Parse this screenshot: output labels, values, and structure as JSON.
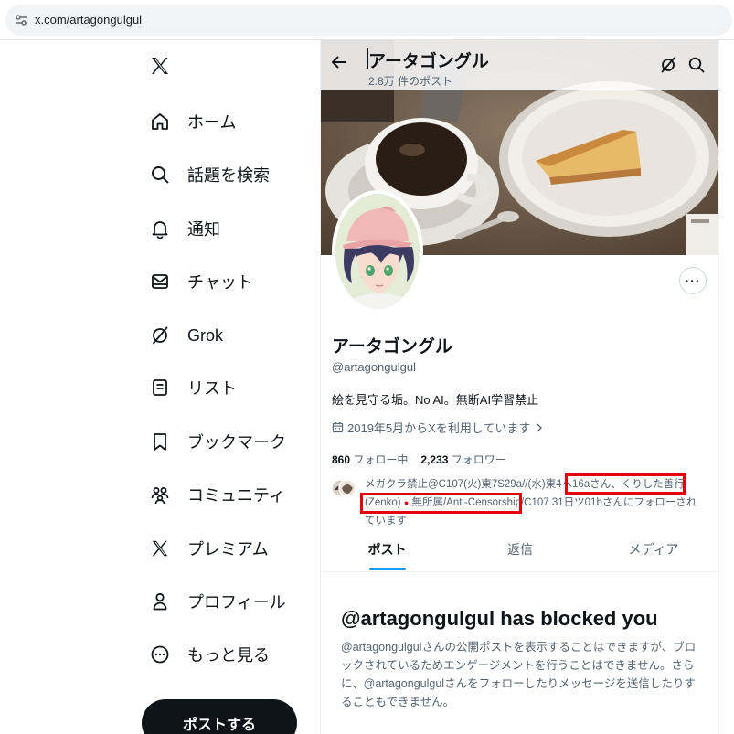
{
  "browser": {
    "url": "x.com/artagongulgul"
  },
  "nav": {
    "items": [
      {
        "label": "ホーム",
        "icon": "home-icon"
      },
      {
        "label": "話題を検索",
        "icon": "search-icon"
      },
      {
        "label": "通知",
        "icon": "bell-icon"
      },
      {
        "label": "チャット",
        "icon": "envelope-icon"
      },
      {
        "label": "Grok",
        "icon": "grok-icon"
      },
      {
        "label": "リスト",
        "icon": "list-icon"
      },
      {
        "label": "ブックマーク",
        "icon": "bookmark-icon"
      },
      {
        "label": "コミュニティ",
        "icon": "community-icon"
      },
      {
        "label": "プレミアム",
        "icon": "x-logo-icon"
      },
      {
        "label": "プロフィール",
        "icon": "person-icon"
      },
      {
        "label": "もっと見る",
        "icon": "more-circle-icon"
      }
    ],
    "post_button": "ポストする"
  },
  "header": {
    "title": "アータゴングル",
    "post_count": "2.8万 件のポスト"
  },
  "profile": {
    "name": "アータゴングル",
    "handle": "@artagongulgul",
    "bio": "絵を見守る垢。No AI。無断AI学習禁止",
    "joined": "2019年5月からXを利用しています",
    "following_count": "860",
    "following_label": "フォロー中",
    "followers_count": "2,233",
    "followers_label": "フォロワー",
    "followed_by": {
      "part1": "メガクラ禁止@C107(火)東7S29a//(水)東4ヘ16aさん、",
      "part2": "くりした善行 (Zenko)",
      "part3": "無所属/Anti-Censorship/C107 31日ツ01bさん",
      "part4": "にフォローされています"
    }
  },
  "tabs": [
    "ポスト",
    "返信",
    "メディア"
  ],
  "blocked": {
    "title": "@artagongulgul has blocked you",
    "text": "@artagongulgulさんの公開ポストを表示することはできますが、ブロックされているためエンゲージメントを行うことはできません。さらに、@artagongulgulさんをフォローしたりメッセージを送信したりすることもできません。"
  },
  "colors": {
    "accent": "#1d9bf0",
    "highlight": "#e6000c",
    "text_secondary": "#536471"
  }
}
